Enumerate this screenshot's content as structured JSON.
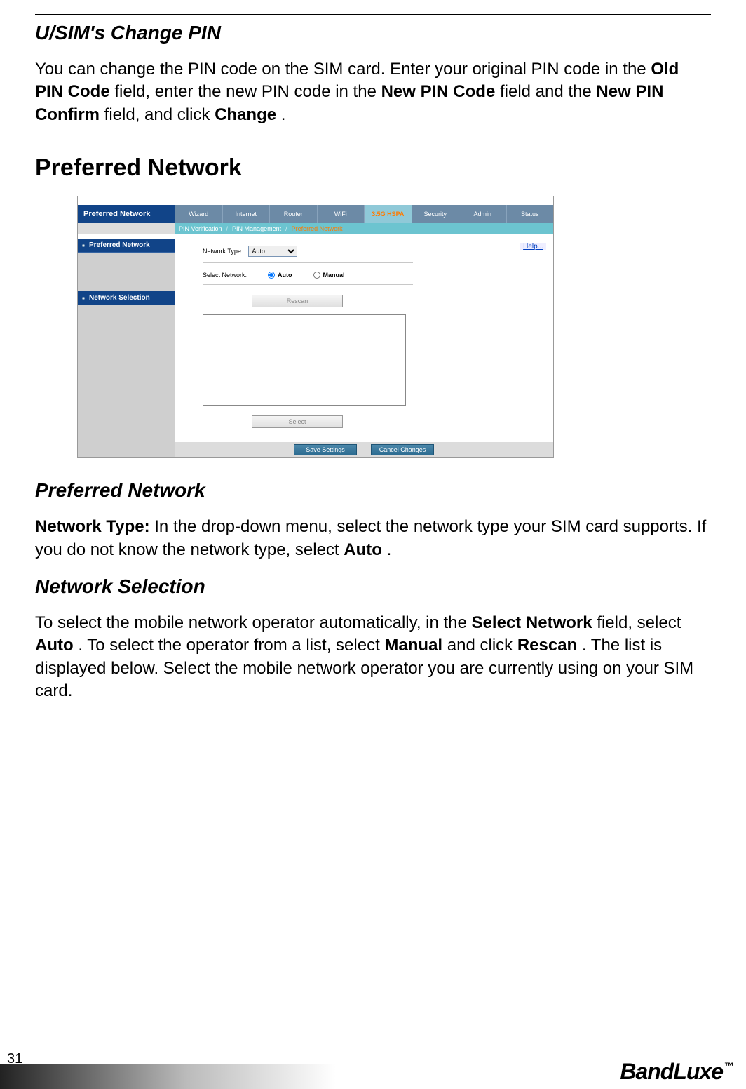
{
  "doc": {
    "heading1": "U/SIM's Change PIN",
    "para1_a": "You can change the PIN code on the SIM card. Enter your original PIN code in the ",
    "para1_b": "Old PIN Code",
    "para1_c": " field, enter the new PIN code in the ",
    "para1_d": "New PIN Code",
    "para1_e": " field and the ",
    "para1_f": "New PIN Confirm",
    "para1_g": " field, and click ",
    "para1_h": "Change",
    "para1_i": ".",
    "heading2": "Preferred Network",
    "heading3": "Preferred Network",
    "para2_a": "Network Type:",
    "para2_b": " In the drop-down menu, select the network type your SIM card supports. If you do not know the network type, select ",
    "para2_c": "Auto",
    "para2_d": ".",
    "heading4": "Network Selection",
    "para3_a": "To select the mobile network operator automatically, in the ",
    "para3_b": "Select Network",
    "para3_c": " field, select ",
    "para3_d": "Auto",
    "para3_e": ". To select the operator from a list, select ",
    "para3_f": "Manual",
    "para3_g": " and click ",
    "para3_h": "Rescan",
    "para3_i": ". The list is displayed below. Select the mobile network operator you are currently using on your SIM card.",
    "page_number": "31",
    "brand": "BandLuxe",
    "tm": "™"
  },
  "ui": {
    "header_left": "Preferred Network",
    "tabs": [
      "Wizard",
      "Internet",
      "Router",
      "WiFi",
      "3.5G HSPA",
      "Security",
      "Admin",
      "Status"
    ],
    "active_tab_index": 4,
    "subtabs": [
      "PIN Verification",
      "PIN Management",
      "Preferred Network"
    ],
    "active_subtab_index": 2,
    "subtab_sep": "/",
    "side": {
      "items": [
        "Preferred Network",
        "Network Selection"
      ]
    },
    "help_label": "Help...",
    "network_type_label": "Network Type:",
    "network_type_value": "Auto",
    "select_network_label": "Select Network:",
    "radio_auto": "Auto",
    "radio_manual": "Manual",
    "rescan_label": "Rescan",
    "select_label": "Select",
    "save_label": "Save Settings",
    "cancel_label": "Cancel Changes"
  }
}
